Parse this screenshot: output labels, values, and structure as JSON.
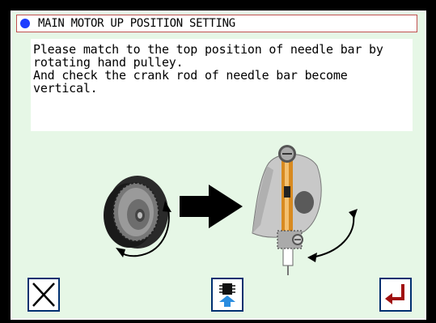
{
  "dialog": {
    "title": "MAIN MOTOR UP POSITION SETTING",
    "message_lines": [
      "Please match to the top position of needle bar by",
      "rotating hand pulley.",
      "And check the crank rod of needle bar become",
      "vertical."
    ]
  },
  "buttons": {
    "cancel": {
      "icon": "close-x-icon"
    },
    "transfer": {
      "icon": "upload-chip-icon"
    },
    "enter": {
      "icon": "enter-return-icon"
    }
  },
  "illustration": {
    "left_icon": "hand-pulley-rotate-icon",
    "arrow_icon": "arrow-right-icon",
    "right_icon": "needle-bar-crank-icon"
  },
  "colors": {
    "panel_background": "#e6f7e6",
    "title_dot": "#1d3dff",
    "button_border": "#003070",
    "enter_icon": "#a01010"
  }
}
